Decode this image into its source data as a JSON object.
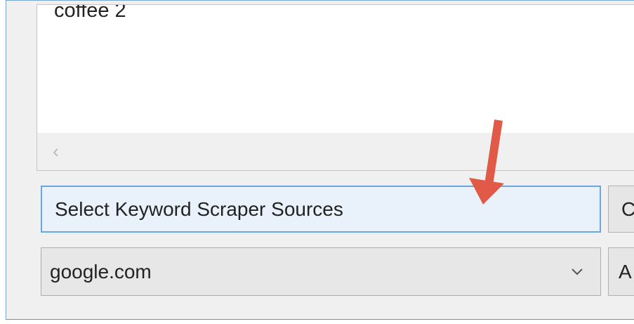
{
  "keyword_list": {
    "items": [
      "coffee 2"
    ],
    "scroll_left_icon": "chevron-left-icon"
  },
  "source_button": {
    "label": "Select Keyword Scraper Sources"
  },
  "right_button_top": {
    "label": "C"
  },
  "domain_select": {
    "value": "google.com",
    "icon": "chevron-down-icon"
  },
  "right_button_bottom": {
    "label": "A"
  },
  "annotation": {
    "color": "#e05a47",
    "icon": "arrow-down-icon"
  }
}
